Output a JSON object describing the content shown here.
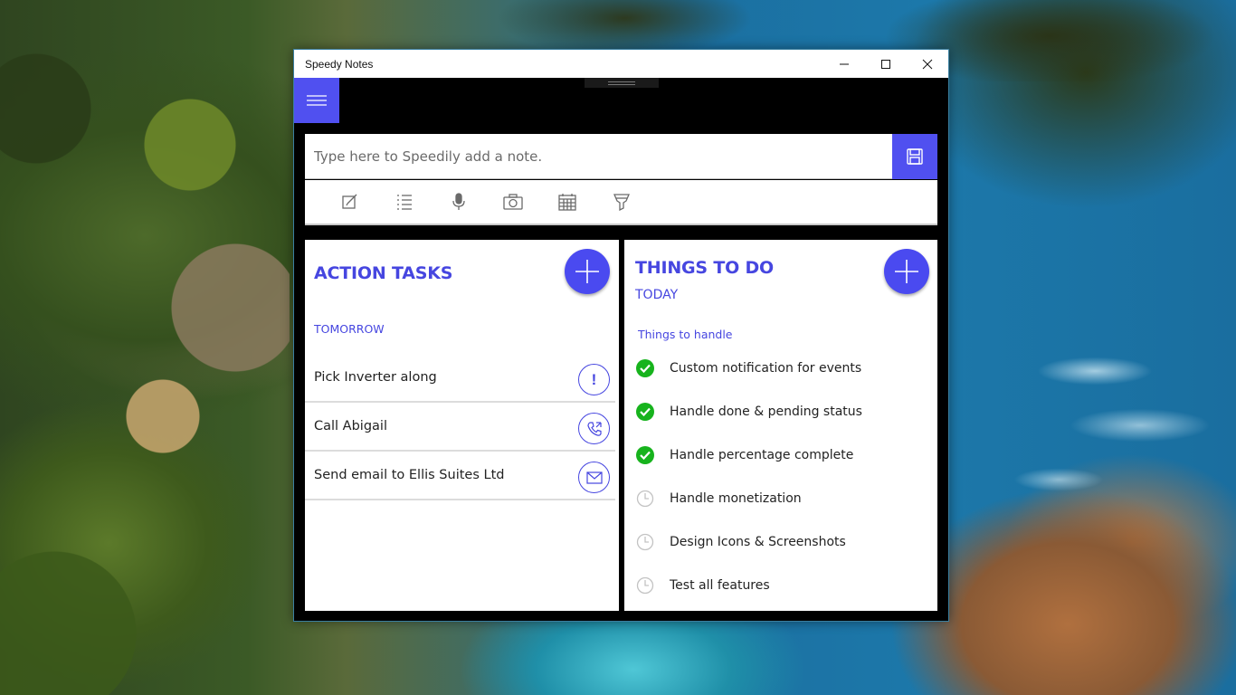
{
  "window": {
    "title": "Speedy Notes"
  },
  "note": {
    "placeholder": "Type here to Speedily add a note."
  },
  "toolbar": {
    "tools": [
      "edit-note-icon",
      "list-icon",
      "microphone-icon",
      "camera-icon",
      "calendar-icon",
      "highlighter-icon"
    ]
  },
  "action_tasks": {
    "title": "ACTION TASKS",
    "section": "TOMORROW",
    "items": [
      {
        "text": "Pick Inverter along",
        "action_icon": "alert-icon",
        "action_glyph": "!"
      },
      {
        "text": "Call Abigail",
        "action_icon": "phone-icon"
      },
      {
        "text": "Send email to Ellis Suites Ltd",
        "action_icon": "mail-icon"
      }
    ]
  },
  "things_to_do": {
    "title": "THINGS TO DO",
    "subtitle": "TODAY",
    "section": "Things to handle",
    "items": [
      {
        "text": "Custom notification for events",
        "status": "done"
      },
      {
        "text": "Handle done & pending status",
        "status": "done"
      },
      {
        "text": "Handle percentage complete",
        "status": "done"
      },
      {
        "text": "Handle monetization",
        "status": "pending"
      },
      {
        "text": "Design Icons & Screenshots",
        "status": "pending"
      },
      {
        "text": "Test all features",
        "status": "pending"
      }
    ]
  },
  "colors": {
    "accent": "#5050f0",
    "done": "#17b31d",
    "pending": "#c3c3c3"
  }
}
